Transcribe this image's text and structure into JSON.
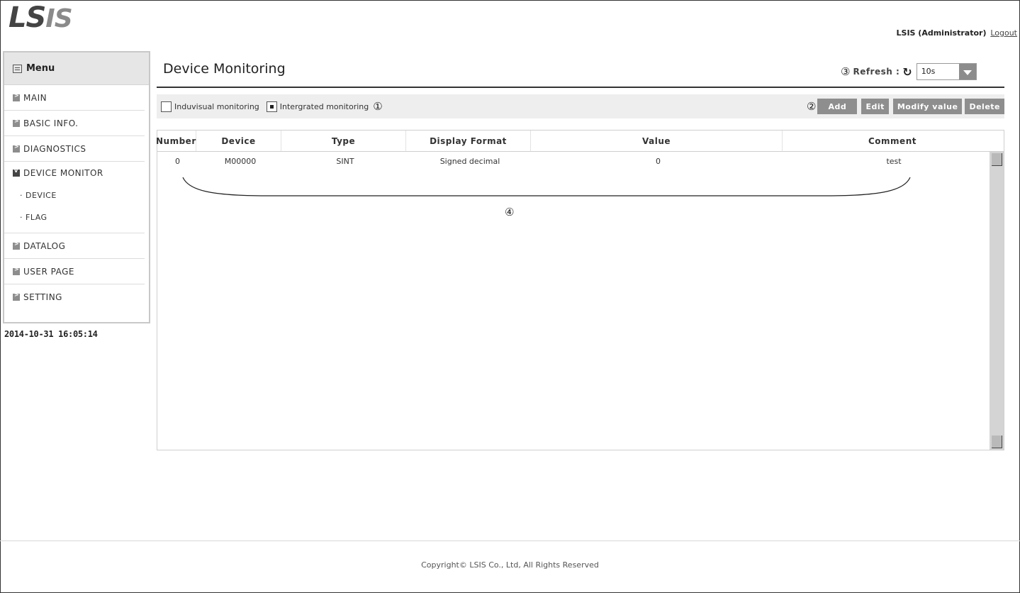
{
  "header": {
    "logo_main": "LS",
    "logo_sub": "IS",
    "user_label": "LSIS (Administrator)",
    "logout_label": "Logout"
  },
  "sidebar": {
    "title": "Menu",
    "items": [
      {
        "label": "MAIN"
      },
      {
        "label": "BASIC INFO."
      },
      {
        "label": "DIAGNOSTICS"
      },
      {
        "label": "DEVICE MONITOR",
        "expanded": true
      },
      {
        "label": "DATALOG"
      },
      {
        "label": "USER PAGE"
      },
      {
        "label": "SETTING"
      }
    ],
    "subitems": [
      {
        "label": "· DEVICE"
      },
      {
        "label": "· FLAG"
      }
    ],
    "datetime": "2014-10-31 16:05:14"
  },
  "main": {
    "title": "Device Monitoring",
    "refresh": {
      "marker": "③",
      "label": "Refresh :",
      "icon": "refresh-icon",
      "value": "10s"
    },
    "toolbar": {
      "individual_label": "Induvisual monitoring",
      "individual_checked": false,
      "integrated_label": "Intergrated monitoring",
      "integrated_checked": true,
      "marker1": "①",
      "marker2": "②",
      "buttons": {
        "add": "Add",
        "edit": "Edit",
        "modify": "Modify value",
        "delete": "Delete"
      }
    },
    "grid": {
      "columns": [
        "Number",
        "Device",
        "Type",
        "Display Format",
        "Value",
        "Comment"
      ],
      "rows": [
        [
          "0",
          "M00000",
          "SINT",
          "Signed decimal",
          "0",
          "test"
        ]
      ]
    },
    "marker4": "④"
  },
  "footer": {
    "copyright": "Copyright© LSIS Co., Ltd, All Rights Reserved"
  }
}
